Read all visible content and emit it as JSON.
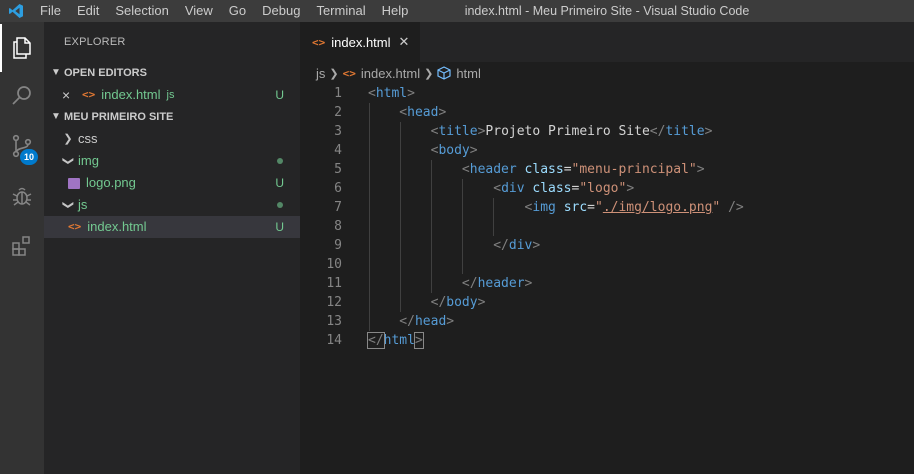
{
  "menu": {
    "items": [
      "File",
      "Edit",
      "Selection",
      "View",
      "Go",
      "Debug",
      "Terminal",
      "Help"
    ],
    "window_title": "index.html - Meu Primeiro Site - Visual Studio Code"
  },
  "activity": {
    "scm_badge": "10"
  },
  "sidebar": {
    "title": "EXPLORER",
    "open_editors": {
      "header": "OPEN EDITORS",
      "file_name": "index.html",
      "file_folder": "js",
      "status": "U"
    },
    "project": {
      "header": "MEU PRIMEIRO SITE",
      "tree": [
        {
          "name": "css",
          "status": ""
        },
        {
          "name": "img",
          "status": ""
        },
        {
          "name": "logo.png",
          "status": "U"
        },
        {
          "name": "js",
          "status": ""
        },
        {
          "name": "index.html",
          "status": "U"
        }
      ]
    }
  },
  "editor": {
    "tab_label": "index.html",
    "breadcrumb": [
      "js",
      "index.html",
      "html"
    ],
    "lines": [
      {
        "n": "1",
        "parts": [
          [
            "p",
            "<"
          ],
          [
            "t",
            "html"
          ],
          [
            "p",
            ">"
          ]
        ]
      },
      {
        "n": "2",
        "parts": [
          [
            "p",
            "    <"
          ],
          [
            "t",
            "head"
          ],
          [
            "p",
            ">"
          ]
        ]
      },
      {
        "n": "3",
        "parts": [
          [
            "p",
            "        <"
          ],
          [
            "t",
            "title"
          ],
          [
            "p",
            ">"
          ],
          [
            "x",
            "Projeto Primeiro Site"
          ],
          [
            "p",
            "</"
          ],
          [
            "t",
            "title"
          ],
          [
            "p",
            ">"
          ]
        ]
      },
      {
        "n": "4",
        "parts": [
          [
            "p",
            "        <"
          ],
          [
            "t",
            "body"
          ],
          [
            "p",
            ">"
          ]
        ]
      },
      {
        "n": "5",
        "parts": [
          [
            "p",
            "            <"
          ],
          [
            "t",
            "header"
          ],
          [
            "x",
            " "
          ],
          [
            "a",
            "class"
          ],
          [
            "x",
            "="
          ],
          [
            "s",
            "\"menu-principal\""
          ],
          [
            "p",
            ">"
          ]
        ]
      },
      {
        "n": "6",
        "parts": [
          [
            "p",
            "                <"
          ],
          [
            "t",
            "div"
          ],
          [
            "x",
            " "
          ],
          [
            "a",
            "class"
          ],
          [
            "x",
            "="
          ],
          [
            "s",
            "\"logo\""
          ],
          [
            "p",
            ">"
          ]
        ]
      },
      {
        "n": "7",
        "parts": [
          [
            "p",
            "                    <"
          ],
          [
            "t",
            "img"
          ],
          [
            "x",
            " "
          ],
          [
            "a",
            "src"
          ],
          [
            "x",
            "="
          ],
          [
            "s",
            "\""
          ],
          [
            "l",
            "./img/logo.png"
          ],
          [
            "s",
            "\""
          ],
          [
            "x",
            " "
          ],
          [
            "p",
            "/>"
          ]
        ]
      },
      {
        "n": "8",
        "parts": []
      },
      {
        "n": "9",
        "parts": [
          [
            "p",
            "                </"
          ],
          [
            "t",
            "div"
          ],
          [
            "p",
            ">"
          ]
        ]
      },
      {
        "n": "10",
        "parts": []
      },
      {
        "n": "11",
        "parts": [
          [
            "p",
            "            </"
          ],
          [
            "t",
            "header"
          ],
          [
            "p",
            ">"
          ]
        ]
      },
      {
        "n": "12",
        "parts": [
          [
            "p",
            "        </"
          ],
          [
            "t",
            "body"
          ],
          [
            "p",
            ">"
          ]
        ]
      },
      {
        "n": "13",
        "parts": [
          [
            "p",
            "    </"
          ],
          [
            "t",
            "head"
          ],
          [
            "p",
            ">"
          ]
        ]
      },
      {
        "n": "14",
        "parts": [
          [
            "p",
            "</"
          ],
          [
            "t",
            "html"
          ],
          [
            "p",
            ">"
          ]
        ]
      }
    ]
  }
}
